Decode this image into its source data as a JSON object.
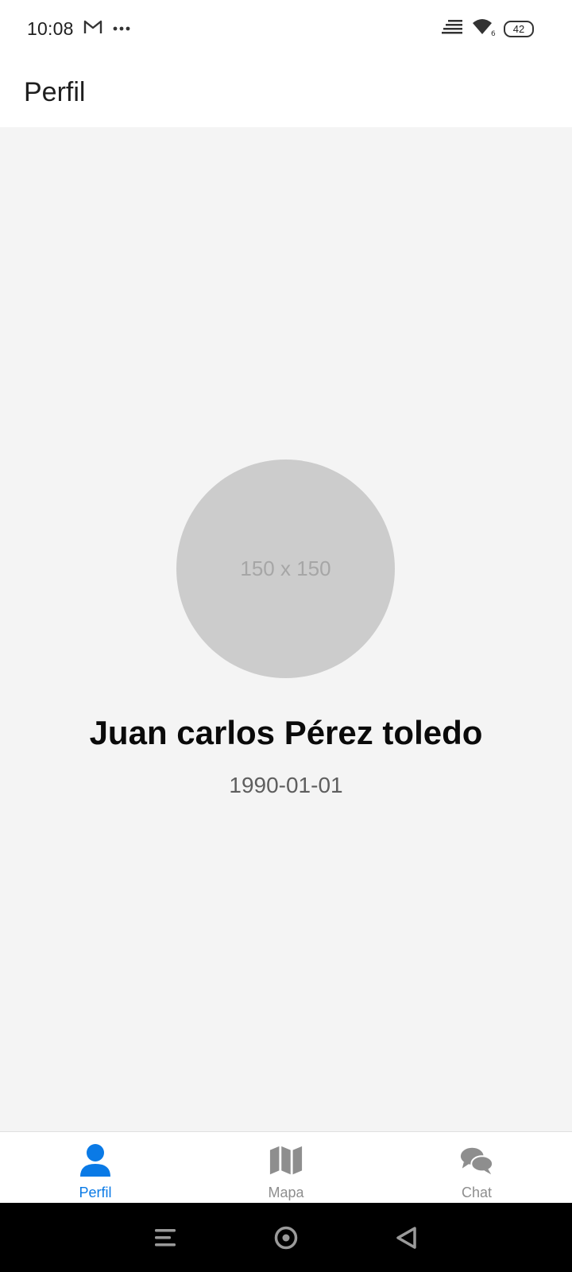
{
  "status_bar": {
    "time": "10:08",
    "battery_level": "42",
    "icons": [
      "gmail-icon",
      "more-dots-icon",
      "signal-icon",
      "wifi-icon",
      "battery-icon"
    ]
  },
  "header": {
    "title": "Perfil"
  },
  "profile": {
    "avatar_placeholder": "150 x 150",
    "name": "Juan carlos Pérez toledo",
    "birthdate": "1990-01-01"
  },
  "tabs": [
    {
      "label": "Perfil",
      "icon": "person-icon",
      "active": true
    },
    {
      "label": "Mapa",
      "icon": "map-icon",
      "active": false
    },
    {
      "label": "Chat",
      "icon": "chat-icon",
      "active": false
    }
  ],
  "colors": {
    "accent": "#0a7ae6",
    "inactive": "#8e8e8e",
    "content_bg": "#f4f4f4",
    "avatar_bg": "#cccccc"
  }
}
